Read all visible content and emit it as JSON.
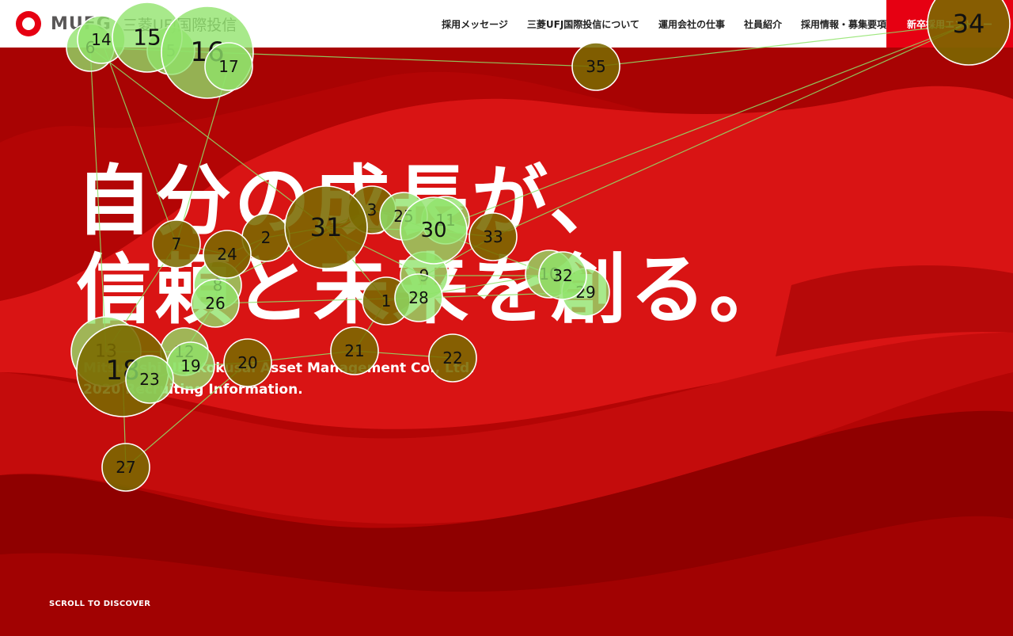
{
  "header": {
    "logo_text": "MUFG",
    "logo_jp": "三菱UFJ国際投信",
    "nav": [
      {
        "label": "採用メッセージ"
      },
      {
        "label": "三菱UFJ国際投信について"
      },
      {
        "label": "運用会社の仕事"
      },
      {
        "label": "社員紹介"
      },
      {
        "label": "採用情報・募集要項"
      }
    ],
    "entry_label": "新卒採用エントリー"
  },
  "hero": {
    "line1": "自分の成長が、",
    "line2": "信頼と未来を創る。",
    "sub1": "Mitsubishi UFJ Kokusai Asset Management Co., Ltd.",
    "sub2": "2020 Recruiting Information."
  },
  "scroll_label": "SCROLL TO DISCOVER",
  "colors": {
    "brand_red": "#e60012",
    "bg_red": "#c40a0a",
    "marker_fill_dark": "#7a6a00",
    "marker_fill_light": "#8fe36a"
  },
  "markers": [
    {
      "n": "1",
      "style": "dark"
    },
    {
      "n": "2",
      "style": "dark"
    },
    {
      "n": "3",
      "style": "dark"
    },
    {
      "n": "5",
      "style": "light"
    },
    {
      "n": "6",
      "style": "light"
    },
    {
      "n": "7",
      "style": "dark"
    },
    {
      "n": "8",
      "style": "light"
    },
    {
      "n": "9",
      "style": "light"
    },
    {
      "n": "10",
      "style": "light"
    },
    {
      "n": "11",
      "style": "light"
    },
    {
      "n": "12",
      "style": "light"
    },
    {
      "n": "13",
      "style": "light"
    },
    {
      "n": "14",
      "style": "light"
    },
    {
      "n": "15",
      "style": "light"
    },
    {
      "n": "16",
      "style": "light"
    },
    {
      "n": "17",
      "style": "light"
    },
    {
      "n": "18",
      "style": "dark"
    },
    {
      "n": "19",
      "style": "light"
    },
    {
      "n": "20",
      "style": "dark"
    },
    {
      "n": "21",
      "style": "dark"
    },
    {
      "n": "22",
      "style": "dark"
    },
    {
      "n": "23",
      "style": "light"
    },
    {
      "n": "24",
      "style": "dark"
    },
    {
      "n": "25",
      "style": "light"
    },
    {
      "n": "26",
      "style": "light"
    },
    {
      "n": "27",
      "style": "dark"
    },
    {
      "n": "28",
      "style": "light"
    },
    {
      "n": "29",
      "style": "light"
    },
    {
      "n": "30",
      "style": "light"
    },
    {
      "n": "31",
      "style": "dark"
    },
    {
      "n": "32",
      "style": "light"
    },
    {
      "n": "33",
      "style": "dark"
    },
    {
      "n": "34",
      "style": "dark"
    },
    {
      "n": "35",
      "style": "dark"
    }
  ]
}
